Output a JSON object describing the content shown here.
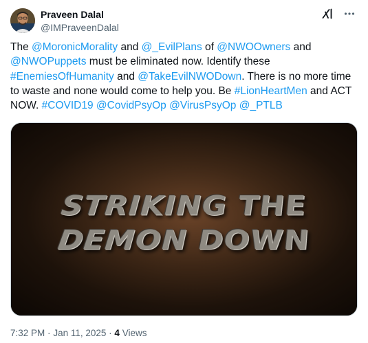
{
  "author": {
    "display_name": "Praveen Dalal",
    "handle": "@IMPraveenDalal"
  },
  "actions": {
    "grok_icon": "grok-icon",
    "more_icon": "more-icon"
  },
  "tweet": {
    "segments": [
      {
        "text": "The ",
        "link": false
      },
      {
        "text": "@MoronicMorality",
        "link": true
      },
      {
        "text": " and ",
        "link": false
      },
      {
        "text": "@_EvilPlans",
        "link": true
      },
      {
        "text": " of ",
        "link": false
      },
      {
        "text": "@NWOOwners",
        "link": true
      },
      {
        "text": " and ",
        "link": false
      },
      {
        "text": "@NWOPuppets",
        "link": true
      },
      {
        "text": " must be eliminated now. Identify these ",
        "link": false
      },
      {
        "text": "#EnemiesOfHumanity",
        "link": true
      },
      {
        "text": " and ",
        "link": false
      },
      {
        "text": "@TakeEvilNWODown",
        "link": true
      },
      {
        "text": ". There is no more time to waste and none would come to help you. Be ",
        "link": false
      },
      {
        "text": "#LionHeartMen",
        "link": true
      },
      {
        "text": " and ACT NOW. ",
        "link": false
      },
      {
        "text": "#COVID19",
        "link": true
      },
      {
        "text": " ",
        "link": false
      },
      {
        "text": "@CovidPsyOp",
        "link": true
      },
      {
        "text": " ",
        "link": false
      },
      {
        "text": "@VirusPsyOp",
        "link": true
      },
      {
        "text": " ",
        "link": false
      },
      {
        "text": "@_PTLB",
        "link": true
      }
    ]
  },
  "media": {
    "line1": "STRIKING THE",
    "line2": "DEMON DOWN"
  },
  "meta": {
    "time": "7:32 PM",
    "separator": "·",
    "date": "Jan 11, 2025",
    "views_count": "4",
    "views_label": "Views"
  },
  "colors": {
    "link": "#1d9bf0",
    "secondary_text": "#536471",
    "primary_text": "#0f1419"
  }
}
